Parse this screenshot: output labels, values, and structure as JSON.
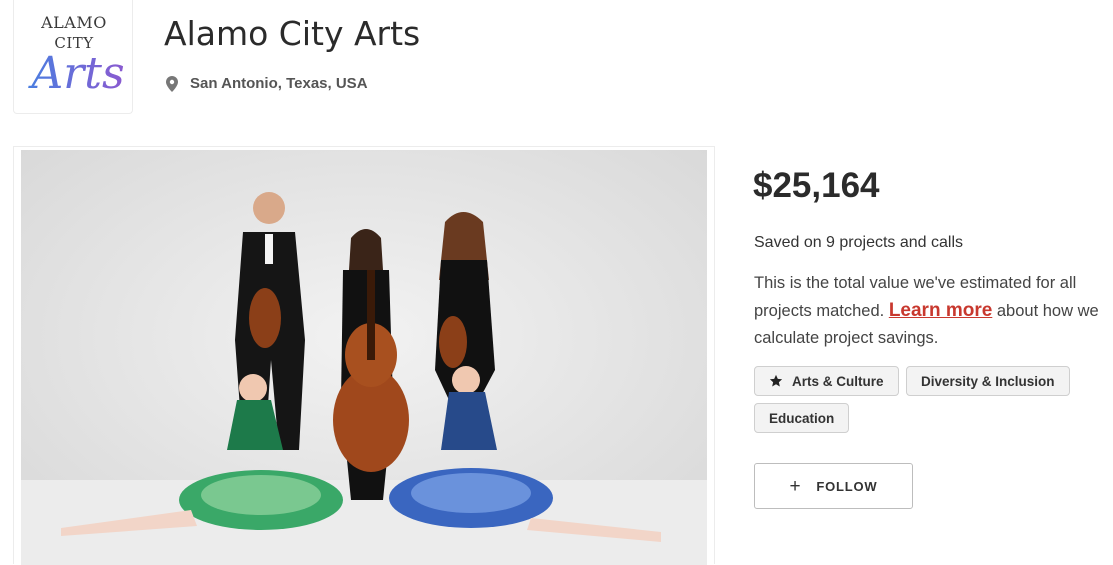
{
  "logo": {
    "line1": "ALAMO",
    "line2": "CITY",
    "script": "Arts"
  },
  "org": {
    "name": "Alamo City Arts",
    "location": "San Antonio, Texas, USA"
  },
  "photo": {
    "icon": "group-photo-musicians-dancers"
  },
  "savings": {
    "amount": "$25,164",
    "saved_text": "Saved on 9 projects and calls",
    "description_before": "This is the total value we've estimated for all projects matched. ",
    "learn_more": "Learn more",
    "description_after": " about how we calculate project savings."
  },
  "tags": [
    {
      "label": "Arts & Culture",
      "icon": "star-icon"
    },
    {
      "label": "Diversity & Inclusion"
    },
    {
      "label": "Education"
    }
  ],
  "follow": {
    "label": "FOLLOW",
    "icon": "plus-icon"
  },
  "colors": {
    "link": "#c8382e",
    "logo_script": "#5a6fd0",
    "tag_bg": "#f3f3f3"
  }
}
